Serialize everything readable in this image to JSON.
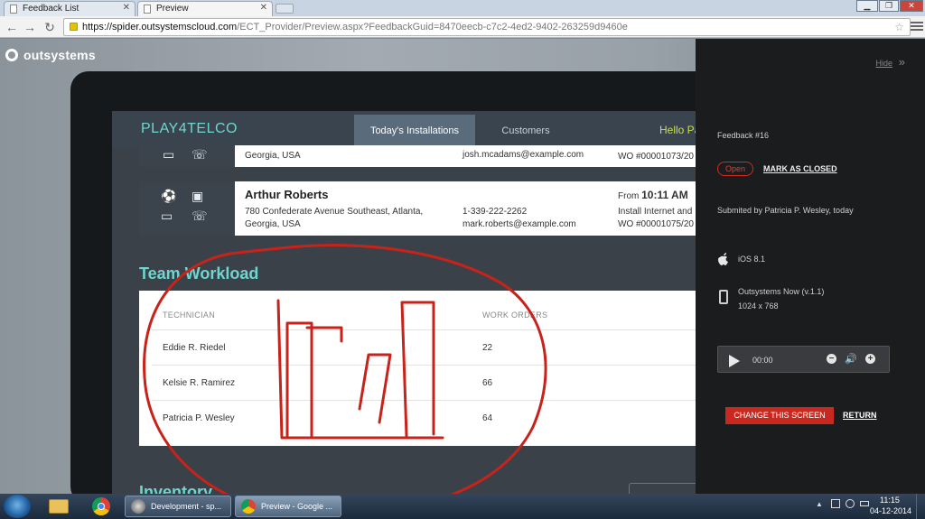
{
  "browser": {
    "tabs": [
      {
        "title": "Feedback List"
      },
      {
        "title": "Preview"
      }
    ],
    "url_host": "https://spider.outsystemscloud.com",
    "url_path": "/ECT_Provider/Preview.aspx?FeedbackGuid=8470eecb-c7c2-4ed2-9402-263259d9460e"
  },
  "page": {
    "brand": "outsystems"
  },
  "app": {
    "logo": "PLAY4TELCO",
    "tabs": {
      "today": "Today's Installations",
      "customers": "Customers"
    },
    "hello": "Hello Pa",
    "installations": [
      {
        "name": "",
        "address_line2": "Georgia, USA",
        "email": "josh.mcadams@example.com",
        "wo": "WO #00001073/20"
      },
      {
        "name": "Arthur Roberts",
        "address_line1": "780 Confederate Avenue Southeast, Atlanta,",
        "address_line2": "Georgia, USA",
        "phone": "1-339-222-2262",
        "email": "mark.roberts@example.com",
        "from_label": "From",
        "from_time": "10:11 AM",
        "service": "Install Internet and",
        "wo": "WO #00001075/20"
      }
    ],
    "workload": {
      "title": "Team Workload",
      "col_technician": "TECHNICIAN",
      "col_orders": "WORK ORDERS",
      "rows": [
        {
          "technician": "Eddie R. Riedel",
          "orders": "22"
        },
        {
          "technician": "Kelsie R. Ramirez",
          "orders": "66"
        },
        {
          "technician": "Patricia P. Wesley",
          "orders": "64"
        }
      ]
    },
    "inventory_title": "Inventory"
  },
  "annotation": {
    "color": "#c8231b"
  },
  "feedback": {
    "hide": "Hide",
    "title": "Feedback #16",
    "status": "Open",
    "mark_closed": "MARK AS CLOSED",
    "submitted": "Submited by Patricia P. Wesley, today",
    "os": "iOS 8.1",
    "device_name": "Outsystems Now (v.1.1)",
    "device_res": "1024 x 768",
    "player_time": "00:00",
    "change_screen": "CHANGE THIS SCREEN",
    "return": "RETURN"
  },
  "taskbar": {
    "items": [
      {
        "label": "Development - sp..."
      },
      {
        "label": "Preview - Google ..."
      }
    ],
    "time": "11:15",
    "date": "04-12-2014"
  }
}
